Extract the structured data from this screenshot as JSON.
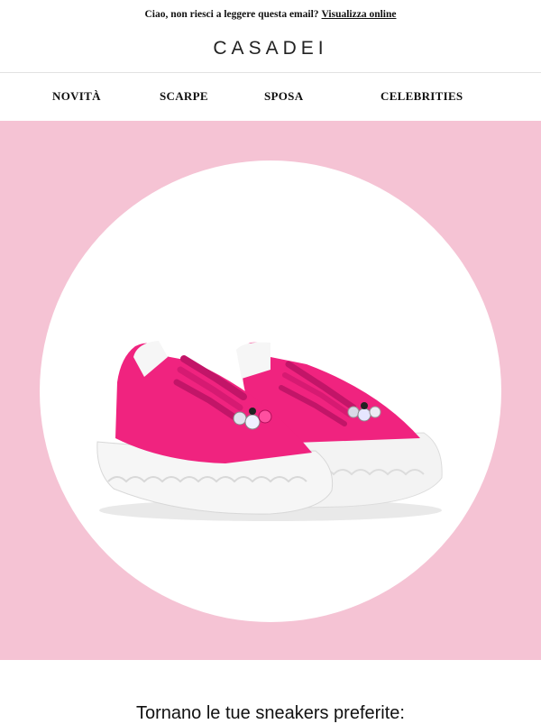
{
  "preheader": {
    "text": "Ciao, non riesci a leggere questa email?",
    "link_label": "Visualizza online"
  },
  "brand": {
    "logo_text": "CASADEI"
  },
  "nav": {
    "items": [
      {
        "label": "NOVITÀ"
      },
      {
        "label": "SCARPE"
      },
      {
        "label": "SPOSA"
      },
      {
        "label": "CELEBRITIES"
      }
    ]
  },
  "hero": {
    "background_color": "#f5c3d4",
    "product_color": "#f0237f",
    "image": "pink-platform-sneakers-with-jewel-embellishment"
  },
  "headline": {
    "text": "Tornano le tue sneakers preferite:"
  }
}
